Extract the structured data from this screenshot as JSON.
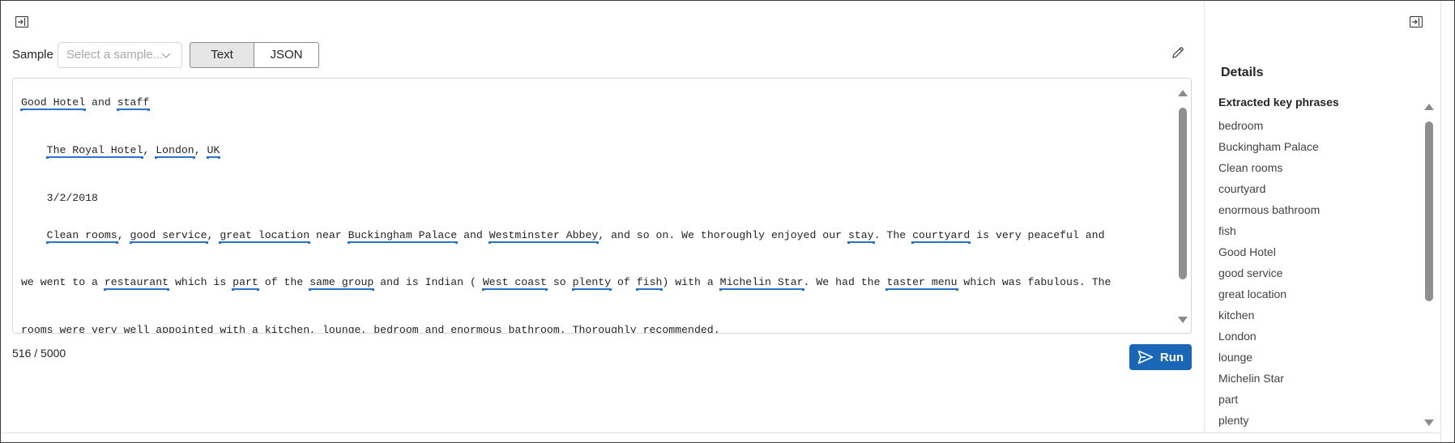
{
  "toolbar": {
    "sample_label": "Sample",
    "sample_placeholder": "Select a sample...",
    "text_tab": "Text",
    "json_tab": "JSON"
  },
  "editor": {
    "lines": [
      [
        {
          "t": "Good Hotel",
          "kp": true
        },
        {
          "t": " and "
        },
        {
          "t": "staff",
          "kp": true
        }
      ],
      [
        {
          "t": "    "
        },
        {
          "t": "The Royal Hotel",
          "kp": true
        },
        {
          "t": ", "
        },
        {
          "t": "London",
          "kp": true
        },
        {
          "t": ", "
        },
        {
          "t": "UK",
          "kp": true
        }
      ],
      [
        {
          "t": "    3/2/2018"
        }
      ],
      [
        {
          "t": "    "
        },
        {
          "t": "Clean rooms",
          "kp": true
        },
        {
          "t": ", "
        },
        {
          "t": "good service",
          "kp": true
        },
        {
          "t": ", "
        },
        {
          "t": "great location",
          "kp": true
        },
        {
          "t": " near "
        },
        {
          "t": "Buckingham Palace",
          "kp": true
        },
        {
          "t": " and "
        },
        {
          "t": "Westminster Abbey",
          "kp": true
        },
        {
          "t": ", and so on. We thoroughly enjoyed our "
        },
        {
          "t": "stay",
          "kp": true
        },
        {
          "t": ". The "
        },
        {
          "t": "courtyard",
          "kp": true
        },
        {
          "t": " is very peaceful and"
        }
      ],
      [
        {
          "t": "we went to a "
        },
        {
          "t": "restaurant",
          "kp": true
        },
        {
          "t": " which is "
        },
        {
          "t": "part",
          "kp": true
        },
        {
          "t": " of the "
        },
        {
          "t": "same group",
          "kp": true
        },
        {
          "t": " and is Indian ( "
        },
        {
          "t": "West coast",
          "kp": true
        },
        {
          "t": " so "
        },
        {
          "t": "plenty",
          "kp": true
        },
        {
          "t": " of "
        },
        {
          "t": "fish",
          "kp": true
        },
        {
          "t": ") with a "
        },
        {
          "t": "Michelin Star",
          "kp": true
        },
        {
          "t": ". We had the "
        },
        {
          "t": "taster menu",
          "kp": true
        },
        {
          "t": " which was fabulous. The"
        }
      ],
      [
        {
          "t": "rooms were very well appointed with a kitchen, lounge, bedroom and enormous bathroom. Thoroughly recommended."
        }
      ]
    ],
    "char_count": "516 / 5000",
    "run_label": "Run"
  },
  "details": {
    "title": "Details",
    "section_header": "Extracted key phrases",
    "key_phrases": [
      "bedroom",
      "Buckingham Palace",
      "Clean rooms",
      "courtyard",
      "enormous bathroom",
      "fish",
      "Good Hotel",
      "good service",
      "great location",
      "kitchen",
      "London",
      "lounge",
      "Michelin Star",
      "part",
      "plenty"
    ]
  },
  "colors": {
    "accent": "#1a67b8",
    "keyphrase_underline": "#2a73c6"
  },
  "icons": [
    "collapse-panel-icon",
    "chevron-down-icon",
    "pencil-icon",
    "send-icon"
  ]
}
